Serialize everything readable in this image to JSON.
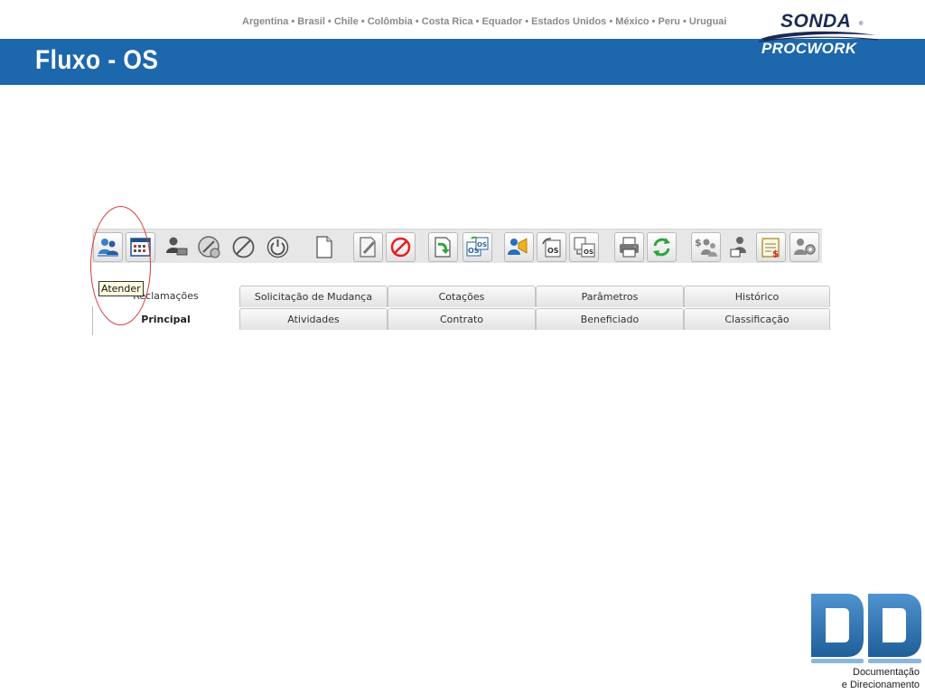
{
  "header": {
    "countries": "Argentina • Brasil • Chile • Colômbia • Costa Rica • Equador • Estados Unidos • México • Peru • Uruguai",
    "title": "Fluxo - OS",
    "logo_top": "SONDA",
    "logo_bottom": "PROCWORK",
    "colors": {
      "title_bar": "#1d67ad",
      "logo_navy": "#1a2a55"
    }
  },
  "toolbar": {
    "buttons": [
      {
        "name": "atender-user-icon"
      },
      {
        "name": "calendar-form-icon"
      },
      {
        "name": "user-transfer-icon"
      },
      {
        "name": "pause-circle-icon"
      },
      {
        "name": "cancel-circle-icon"
      },
      {
        "name": "power-icon"
      },
      {
        "name": "new-document-icon"
      },
      {
        "name": "edit-document-icon"
      },
      {
        "name": "forbidden-icon"
      },
      {
        "name": "document-next-icon"
      },
      {
        "name": "os-copy-icon"
      },
      {
        "name": "user-announce-icon"
      },
      {
        "name": "os-return-icon"
      },
      {
        "name": "os-split-icon"
      },
      {
        "name": "printer-icon"
      },
      {
        "name": "refresh-icon"
      },
      {
        "name": "users-cost-icon"
      },
      {
        "name": "user-lock-icon"
      },
      {
        "name": "price-list-icon"
      },
      {
        "name": "users-settings-icon"
      }
    ],
    "tooltip": "Atender"
  },
  "tabs": {
    "row1": [
      "Reclamações",
      "Solicitação de Mudança",
      "Cotações",
      "Parâmetros",
      "Histórico"
    ],
    "row2": [
      "Principal",
      "Atividades",
      "Contrato",
      "Beneficiado",
      "Classificação"
    ],
    "active": "Principal"
  },
  "footer_logo": {
    "letters": "DD",
    "caption_line1": "Documentação",
    "caption_line2": "e Direcionamento",
    "color": "#2f6fa7"
  }
}
